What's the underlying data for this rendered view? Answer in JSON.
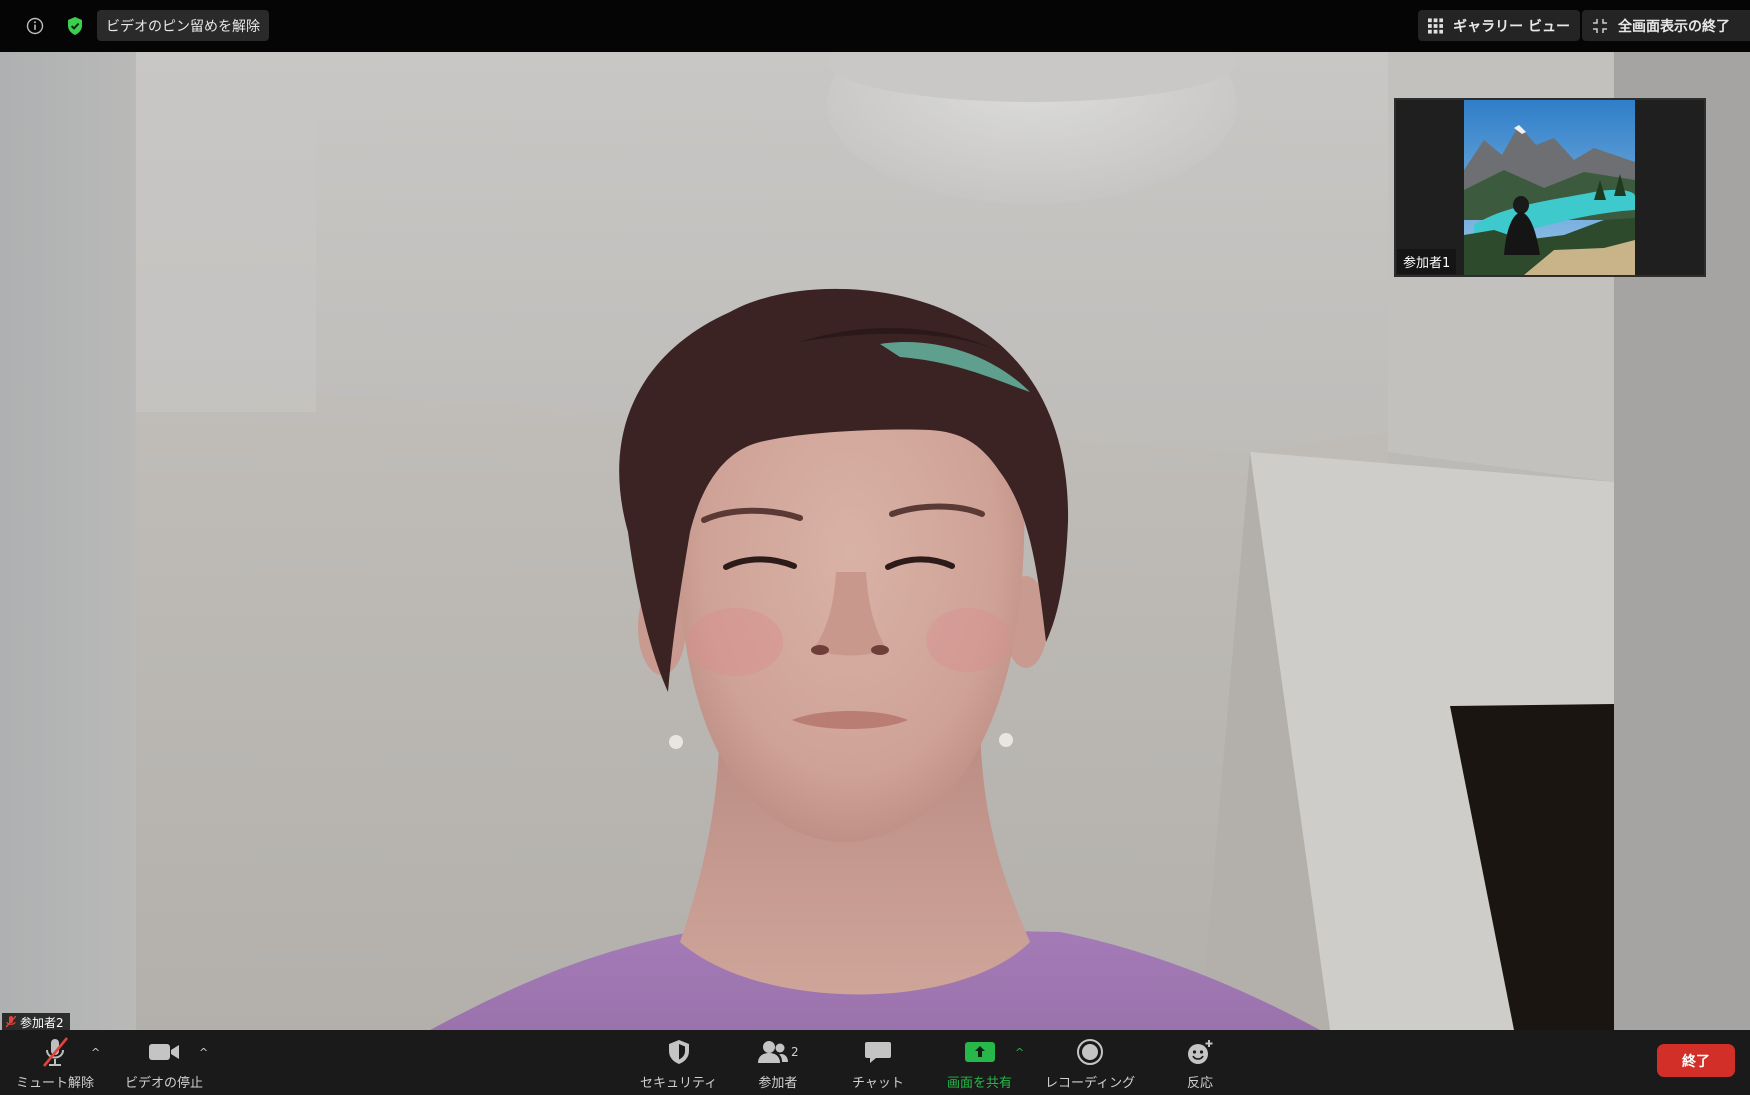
{
  "topbar": {
    "pin_label": "ビデオのピン留めを解除",
    "gallery_label": "ギャラリー ビュー",
    "exit_fullscreen_label": "全画面表示の終了",
    "info_icon": "info-icon",
    "security_shield_icon": "shield-check-icon"
  },
  "video": {
    "thumbnail_participant": "参加者1",
    "main_participant": "参加者2"
  },
  "toolbar": {
    "unmute_label": "ミュート解除",
    "stop_video_label": "ビデオの停止",
    "security_label": "セキュリティ",
    "participants_label": "参加者",
    "participants_count": "2",
    "chat_label": "チャット",
    "share_label": "画面を共有",
    "record_label": "レコーディング",
    "reactions_label": "反応",
    "end_label": "終了"
  },
  "colors": {
    "share_accent": "#27b84a",
    "end_button": "#d12f28",
    "shield_green": "#3ccf4e",
    "mute_red": "#e0443a"
  }
}
